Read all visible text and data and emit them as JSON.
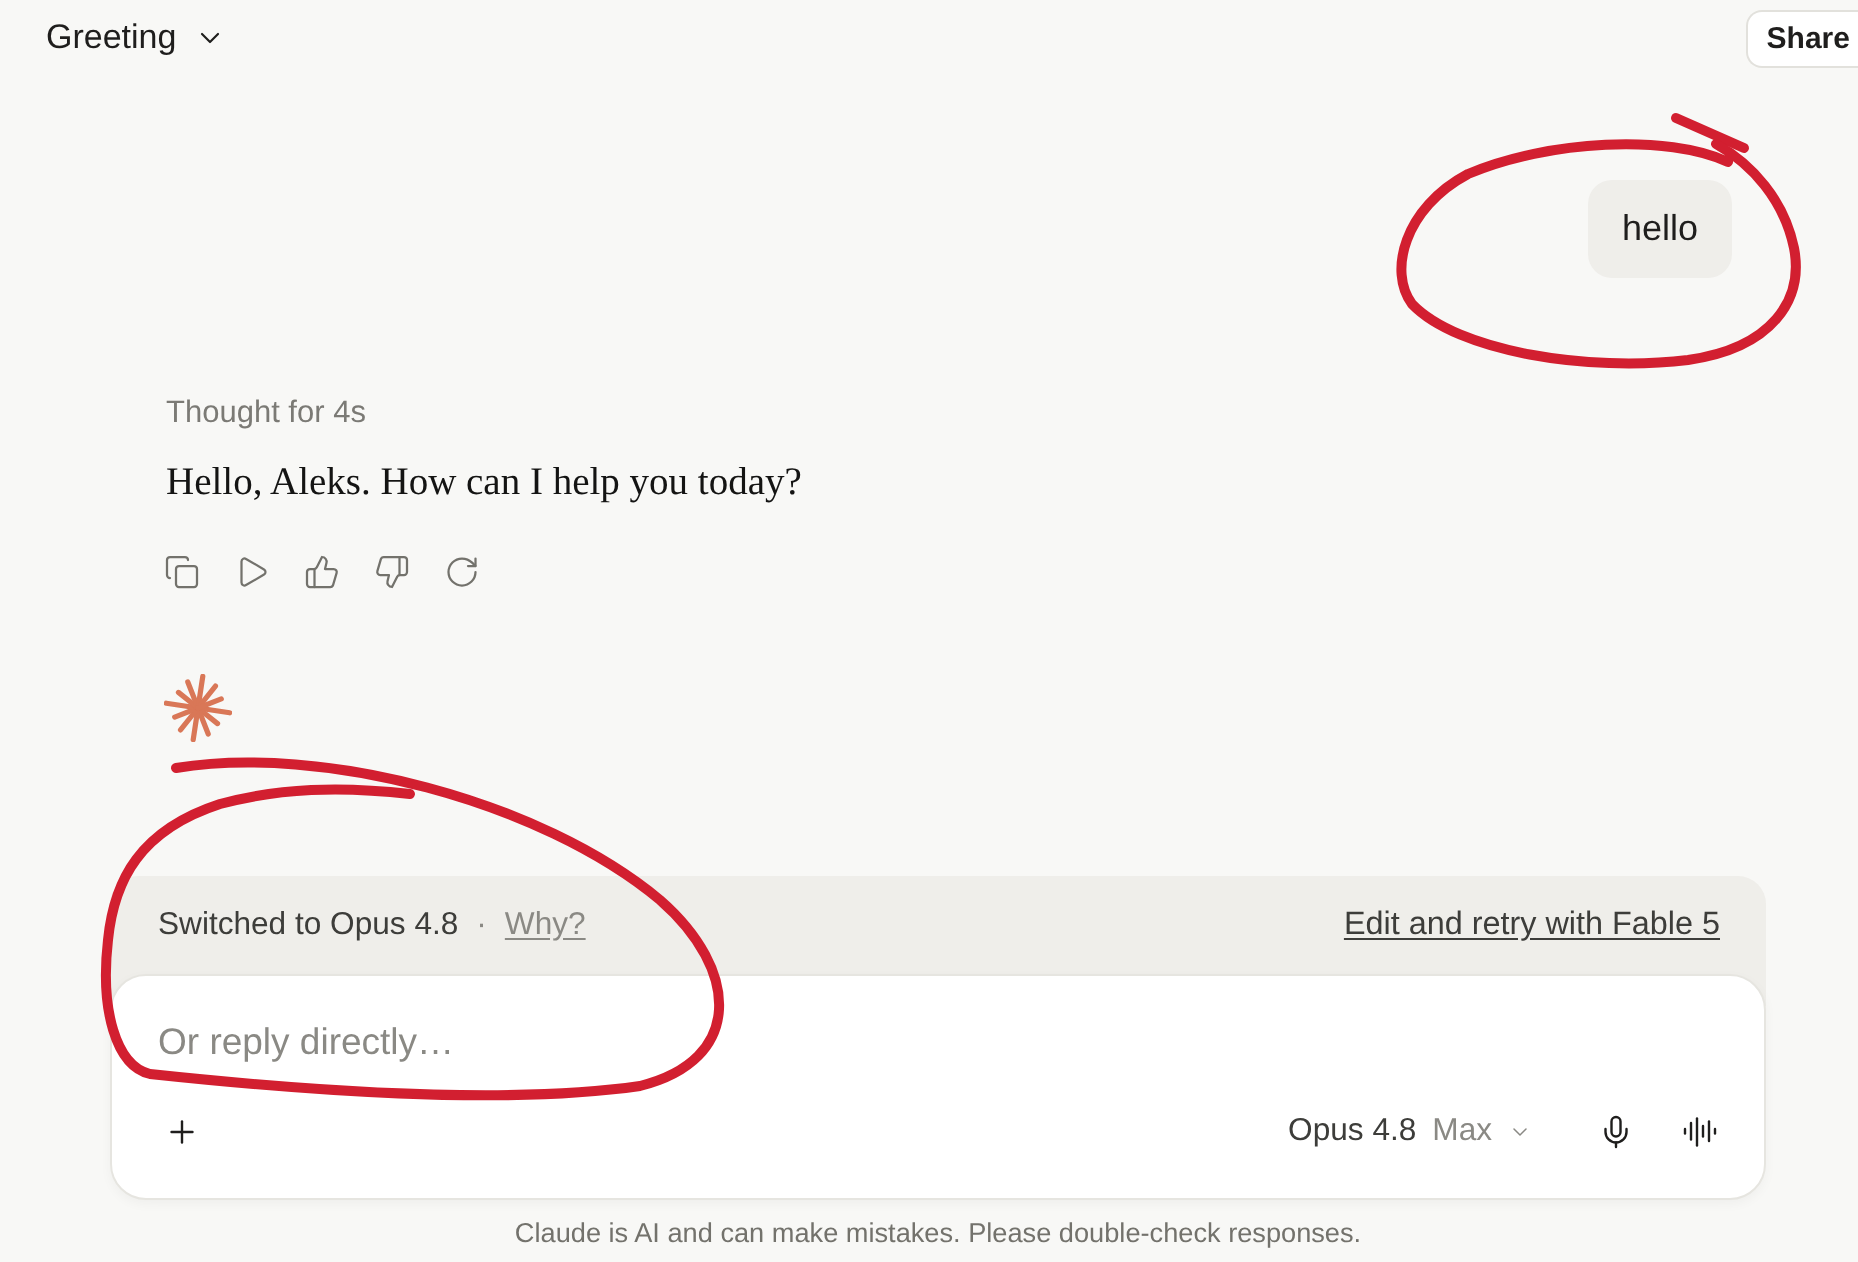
{
  "header": {
    "title": "Greeting",
    "share_button": "Share"
  },
  "messages": [
    {
      "kind": "user",
      "text": "hello"
    },
    {
      "kind": "assistant",
      "thinking": "Thought for 4s",
      "text": "Hello, Aleks. How can I help you today?"
    }
  ],
  "notice": {
    "text": "Switched to Opus 4.8",
    "separator": "·",
    "link": "Why?",
    "action": "Edit and retry with Fable 5"
  },
  "composer": {
    "placeholder": "Or reply directly…",
    "model": "Opus 4.8",
    "effort": "Max"
  },
  "footer": "Claude is AI and can make mistakes. Please double-check responses."
}
